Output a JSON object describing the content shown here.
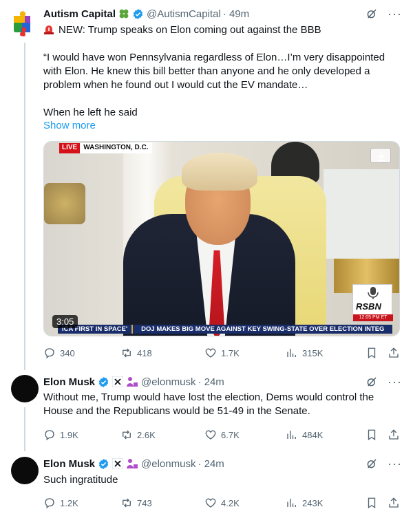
{
  "post": {
    "name": "Autism Capital",
    "handle": "@AutismCapital",
    "time": "· 49m",
    "line1": "NEW: Trump speaks on Elon coming out against the BBB",
    "quote": "“I would have won Pennsylvania regardless of Elon…I’m very disappointed with Elon. He knew this bill better than anyone and he only developed a problem when he found out I would cut the EV mandate…",
    "line3": "When he left he said",
    "show_more": "Show more",
    "video": {
      "live": "LIVE",
      "location": "WASHINGTON, D.C.",
      "duration": "3:05",
      "ticker_left": "ICA FIRST IN SPACE'",
      "ticker_right": "DOJ MAKES BIG MOVE AGAINST KEY SWING-STATE OVER ELECTION INTEG",
      "rsbn": "RSBN",
      "rsbn_time": "12:05 PM ET"
    },
    "stats": {
      "replies": "340",
      "reposts": "418",
      "likes": "1.7K",
      "views": "315K"
    }
  },
  "reply1": {
    "name": "Elon Musk",
    "handle": "@elonmusk",
    "time": "· 24m",
    "text": "Without me, Trump would have lost the election, Dems would control the House and the Republicans would be 51-49 in the Senate.",
    "stats": {
      "replies": "1.9K",
      "reposts": "2.6K",
      "likes": "6.7K",
      "views": "484K"
    }
  },
  "reply2": {
    "name": "Elon Musk",
    "handle": "@elonmusk",
    "time": "· 24m",
    "text": "Such ingratitude",
    "stats": {
      "replies": "1.2K",
      "reposts": "743",
      "likes": "4.2K",
      "views": "243K"
    }
  },
  "colors": {
    "accent": "#1d9bf0",
    "verified": "#1d9bf0",
    "muted": "#536471",
    "live": "#d5121a"
  }
}
